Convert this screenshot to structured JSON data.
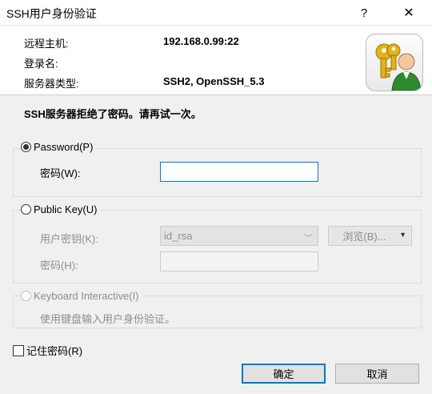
{
  "window": {
    "title": "SSH用户身份验证",
    "help": "?",
    "close": "✕"
  },
  "info": {
    "remote_host_label": "远程主机:",
    "remote_host_value": "192.168.0.99:22",
    "login_name_label": "登录名:",
    "server_type_label": "服务器类型:",
    "server_type_value": "SSH2, OpenSSH_5.3"
  },
  "message": "SSH服务器拒绝了密码。请再试一次。",
  "password": {
    "option_label": "Password(P)",
    "field_label": "密码(W):",
    "value": ""
  },
  "public_key": {
    "option_label": "Public Key(U)",
    "key_label": "用户密钥(K):",
    "key_value": "id_rsa",
    "browse_label": "浏览(B)...",
    "passphrase_label": "密码(H):",
    "passphrase_value": ""
  },
  "keyboard": {
    "option_label": "Keyboard Interactive(I)",
    "description": "使用键盘输入用户身份验证。"
  },
  "remember": {
    "label": "记住密码(R)"
  },
  "buttons": {
    "ok": "确定",
    "cancel": "取消"
  },
  "icons": {
    "host_icon": "keys-user-icon",
    "accent": "#0078d7"
  }
}
